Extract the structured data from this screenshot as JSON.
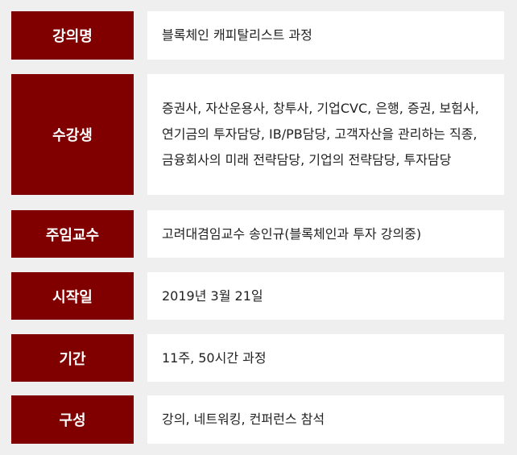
{
  "rows": [
    {
      "label": "강의명",
      "value": "블록체인 캐피탈리스트 과정"
    },
    {
      "label": "수강생",
      "value": "증권사, 자산운용사, 창투사, 기업CVC, 은행, 증권, 보험사, 연기금의 투자담당, IB/PB담당, 고객자산을 관리하는 직종, 금융회사의 미래 전략담당, 기업의 전략담당, 투자담당"
    },
    {
      "label": "주임교수",
      "value": "고려대겸임교수 송인규(블록체인과 투자 강의중)"
    },
    {
      "label": "시작일",
      "value": "2019년 3월 21일"
    },
    {
      "label": "기간",
      "value": "11주, 50시간 과정"
    },
    {
      "label": "구성",
      "value": "강의, 네트워킹, 컨퍼런스 참석"
    }
  ],
  "colors": {
    "label_bg": "#800000",
    "value_bg": "#ffffff",
    "page_bg": "#efefef"
  }
}
